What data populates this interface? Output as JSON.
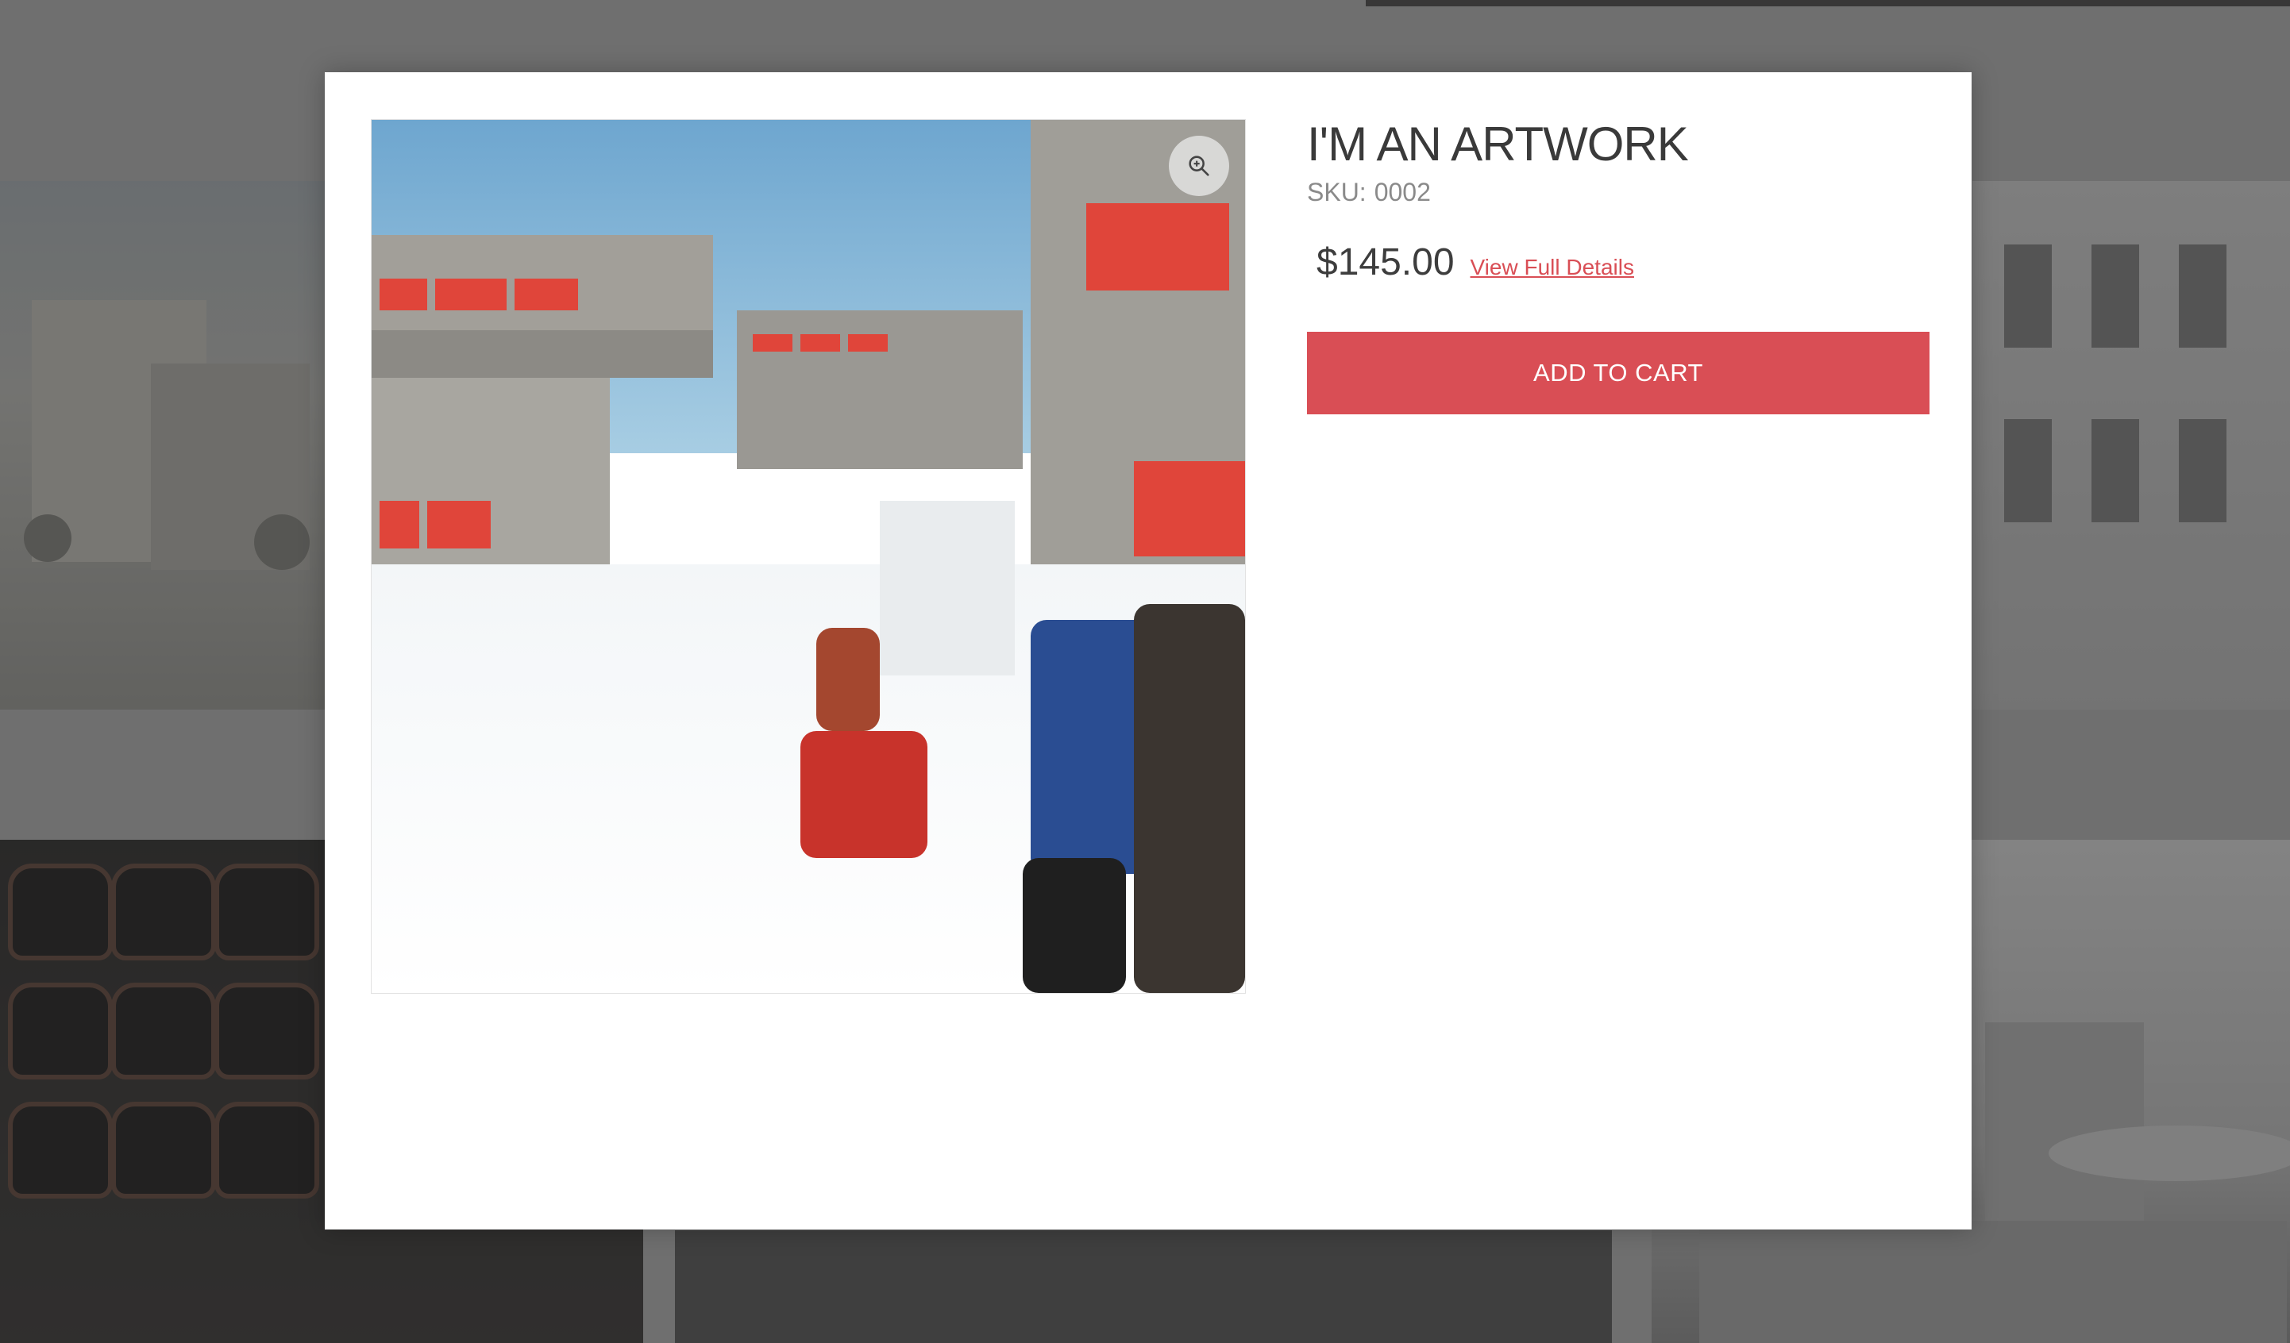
{
  "product": {
    "title": "I'M AN ARTWORK",
    "sku_label": "SKU:",
    "sku_value": "0002",
    "price": "$145.00",
    "details_link": "View Full Details",
    "add_to_cart": "ADD TO CART"
  },
  "icons": {
    "zoom": "zoom-in-icon"
  },
  "colors": {
    "accent": "#d94e55",
    "overlay": "#6f6f6f",
    "modal_bg": "#ffffff",
    "title_text": "#3a3a3a"
  }
}
